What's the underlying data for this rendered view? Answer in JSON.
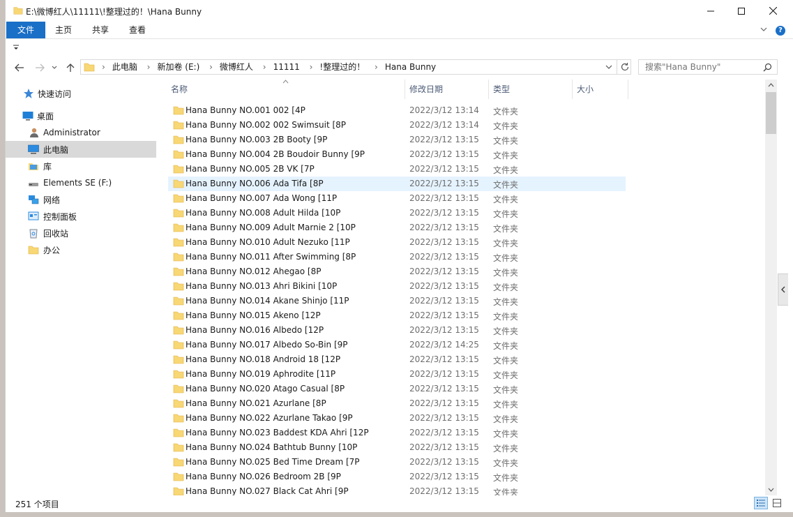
{
  "window": {
    "title": "E:\\微博红人\\11111\\!整理过的！\\Hana Bunny"
  },
  "ribbon": {
    "tabs": [
      "文件",
      "主页",
      "共享",
      "查看"
    ],
    "help_label": "?"
  },
  "nav": {
    "breadcrumb": [
      "此电脑",
      "新加卷 (E:)",
      "微博红人",
      "11111",
      "!整理过的！",
      "Hana Bunny"
    ],
    "search_placeholder": "搜索\"Hana Bunny\""
  },
  "sidebar": {
    "items": [
      {
        "label": "快速访问",
        "icon": "star-icon"
      },
      {
        "label": "桌面",
        "icon": "desktop-icon"
      },
      {
        "label": "Administrator",
        "icon": "user-icon"
      },
      {
        "label": "此电脑",
        "icon": "computer-icon"
      },
      {
        "label": "库",
        "icon": "library-icon"
      },
      {
        "label": "Elements SE (F:)",
        "icon": "drive-icon"
      },
      {
        "label": "网络",
        "icon": "network-icon"
      },
      {
        "label": "控制面板",
        "icon": "control-panel-icon"
      },
      {
        "label": "回收站",
        "icon": "recycle-bin-icon"
      },
      {
        "label": "办公",
        "icon": "folder-icon"
      }
    ]
  },
  "columns": {
    "name": "名称",
    "date": "修改日期",
    "type": "类型",
    "size": "大小"
  },
  "files": [
    {
      "name": "Hana Bunny NO.001 002 [4P",
      "date": "2022/3/12 13:14",
      "type": "文件夹"
    },
    {
      "name": "Hana Bunny NO.002 002 Swimsuit [8P",
      "date": "2022/3/12 13:14",
      "type": "文件夹"
    },
    {
      "name": "Hana Bunny NO.003 2B Booty [9P",
      "date": "2022/3/12 13:15",
      "type": "文件夹"
    },
    {
      "name": "Hana Bunny NO.004 2B Boudoir Bunny [9P",
      "date": "2022/3/12 13:15",
      "type": "文件夹"
    },
    {
      "name": "Hana Bunny NO.005 2B VK [7P",
      "date": "2022/3/12 13:15",
      "type": "文件夹"
    },
    {
      "name": "Hana Bunny NO.006 Ada Tifa [8P",
      "date": "2022/3/12 13:15",
      "type": "文件夹"
    },
    {
      "name": "Hana Bunny NO.007 Ada Wong [11P",
      "date": "2022/3/12 13:15",
      "type": "文件夹"
    },
    {
      "name": "Hana Bunny NO.008 Adult Hilda [10P",
      "date": "2022/3/12 13:15",
      "type": "文件夹"
    },
    {
      "name": "Hana Bunny NO.009 Adult Marnie 2 [10P",
      "date": "2022/3/12 13:15",
      "type": "文件夹"
    },
    {
      "name": "Hana Bunny NO.010 Adult Nezuko [11P",
      "date": "2022/3/12 13:15",
      "type": "文件夹"
    },
    {
      "name": "Hana Bunny NO.011 After Swimming [8P",
      "date": "2022/3/12 13:15",
      "type": "文件夹"
    },
    {
      "name": "Hana Bunny NO.012 Ahegao [8P",
      "date": "2022/3/12 13:15",
      "type": "文件夹"
    },
    {
      "name": "Hana Bunny NO.013 Ahri Bikini [10P",
      "date": "2022/3/12 13:15",
      "type": "文件夹"
    },
    {
      "name": "Hana Bunny NO.014 Akane Shinjo [11P",
      "date": "2022/3/12 13:15",
      "type": "文件夹"
    },
    {
      "name": "Hana Bunny NO.015 Akeno [12P",
      "date": "2022/3/12 13:15",
      "type": "文件夹"
    },
    {
      "name": "Hana Bunny NO.016 Albedo [12P",
      "date": "2022/3/12 13:15",
      "type": "文件夹"
    },
    {
      "name": "Hana Bunny NO.017 Albedo So-Bin [9P",
      "date": "2022/3/12 14:25",
      "type": "文件夹"
    },
    {
      "name": "Hana Bunny NO.018 Android 18 [12P",
      "date": "2022/3/12 13:15",
      "type": "文件夹"
    },
    {
      "name": "Hana Bunny NO.019 Aphrodite [11P",
      "date": "2022/3/12 13:15",
      "type": "文件夹"
    },
    {
      "name": "Hana Bunny NO.020 Atago Casual [8P",
      "date": "2022/3/12 13:15",
      "type": "文件夹"
    },
    {
      "name": "Hana Bunny NO.021 Azurlane [8P",
      "date": "2022/3/12 13:15",
      "type": "文件夹"
    },
    {
      "name": "Hana Bunny NO.022 Azurlane Takao [9P",
      "date": "2022/3/12 13:15",
      "type": "文件夹"
    },
    {
      "name": "Hana Bunny NO.023 Baddest KDA Ahri [12P",
      "date": "2022/3/12 13:15",
      "type": "文件夹"
    },
    {
      "name": "Hana Bunny NO.024 Bathtub Bunny [10P",
      "date": "2022/3/12 13:15",
      "type": "文件夹"
    },
    {
      "name": "Hana Bunny NO.025 Bed Time Dream [7P",
      "date": "2022/3/12 13:15",
      "type": "文件夹"
    },
    {
      "name": "Hana Bunny NO.026 Bedroom 2B [9P",
      "date": "2022/3/12 13:15",
      "type": "文件夹"
    },
    {
      "name": "Hana Bunny NO.027 Black Cat Ahri [9P",
      "date": "2022/3/12 13:15",
      "type": "文件夹"
    }
  ],
  "status": {
    "count": "251 个项目"
  }
}
